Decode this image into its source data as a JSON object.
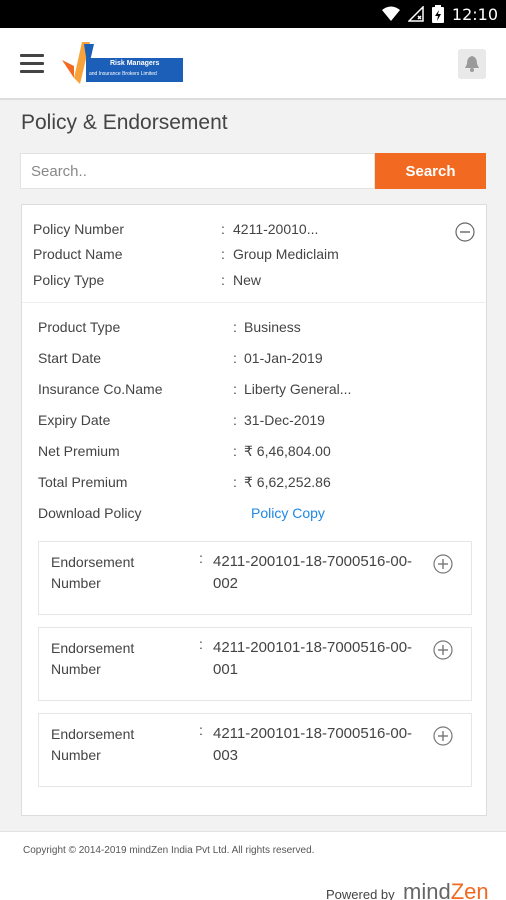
{
  "status": {
    "time": "12:10",
    "icons": [
      "wifi-icon",
      "signal-icon",
      "battery-icon"
    ]
  },
  "header": {
    "logo_title": "Risk Managers",
    "logo_subtitle": "and Insurance Brokers Limited",
    "icons": [
      "menu-icon",
      "bell-icon"
    ]
  },
  "page": {
    "title": "Policy & Endorsement"
  },
  "search": {
    "placeholder": "Search..",
    "value": "",
    "button_label": "Search"
  },
  "policy": {
    "summary": [
      {
        "label": "Policy Number",
        "value": "4211-20010..."
      },
      {
        "label": "Product Name",
        "value": "Group Mediclaim"
      },
      {
        "label": "Policy Type",
        "value": "New"
      }
    ],
    "details": [
      {
        "label": "Product Type",
        "value": "Business"
      },
      {
        "label": "Start Date",
        "value": "01-Jan-2019"
      },
      {
        "label": "Insurance Co.Name",
        "value": "Liberty General..."
      },
      {
        "label": "Expiry Date",
        "value": "31-Dec-2019"
      },
      {
        "label": "Net Premium",
        "value": "₹ 6,46,804.00"
      },
      {
        "label": "Total Premium",
        "value": "₹ 6,62,252.86"
      },
      {
        "label": "Download Policy",
        "value": "Policy Copy"
      }
    ],
    "endorsements": [
      {
        "label": "Endorsement Number",
        "value": "4211-200101-18-7000516-00-002"
      },
      {
        "label": "Endorsement Number",
        "value": "4211-200101-18-7000516-00-001"
      },
      {
        "label": "Endorsement Number",
        "value": "4211-200101-18-7000516-00-003"
      }
    ]
  },
  "footer": {
    "copyright": "Copyright © 2014-2019 mindZen India Pvt Ltd. All rights reserved.",
    "powered_by": "Powered by",
    "brand_part1": "mind",
    "brand_part2": "Zen"
  },
  "colors": {
    "accent": "#f26a21",
    "link": "#1e88e5",
    "logo_blue": "#1c5fb8"
  }
}
